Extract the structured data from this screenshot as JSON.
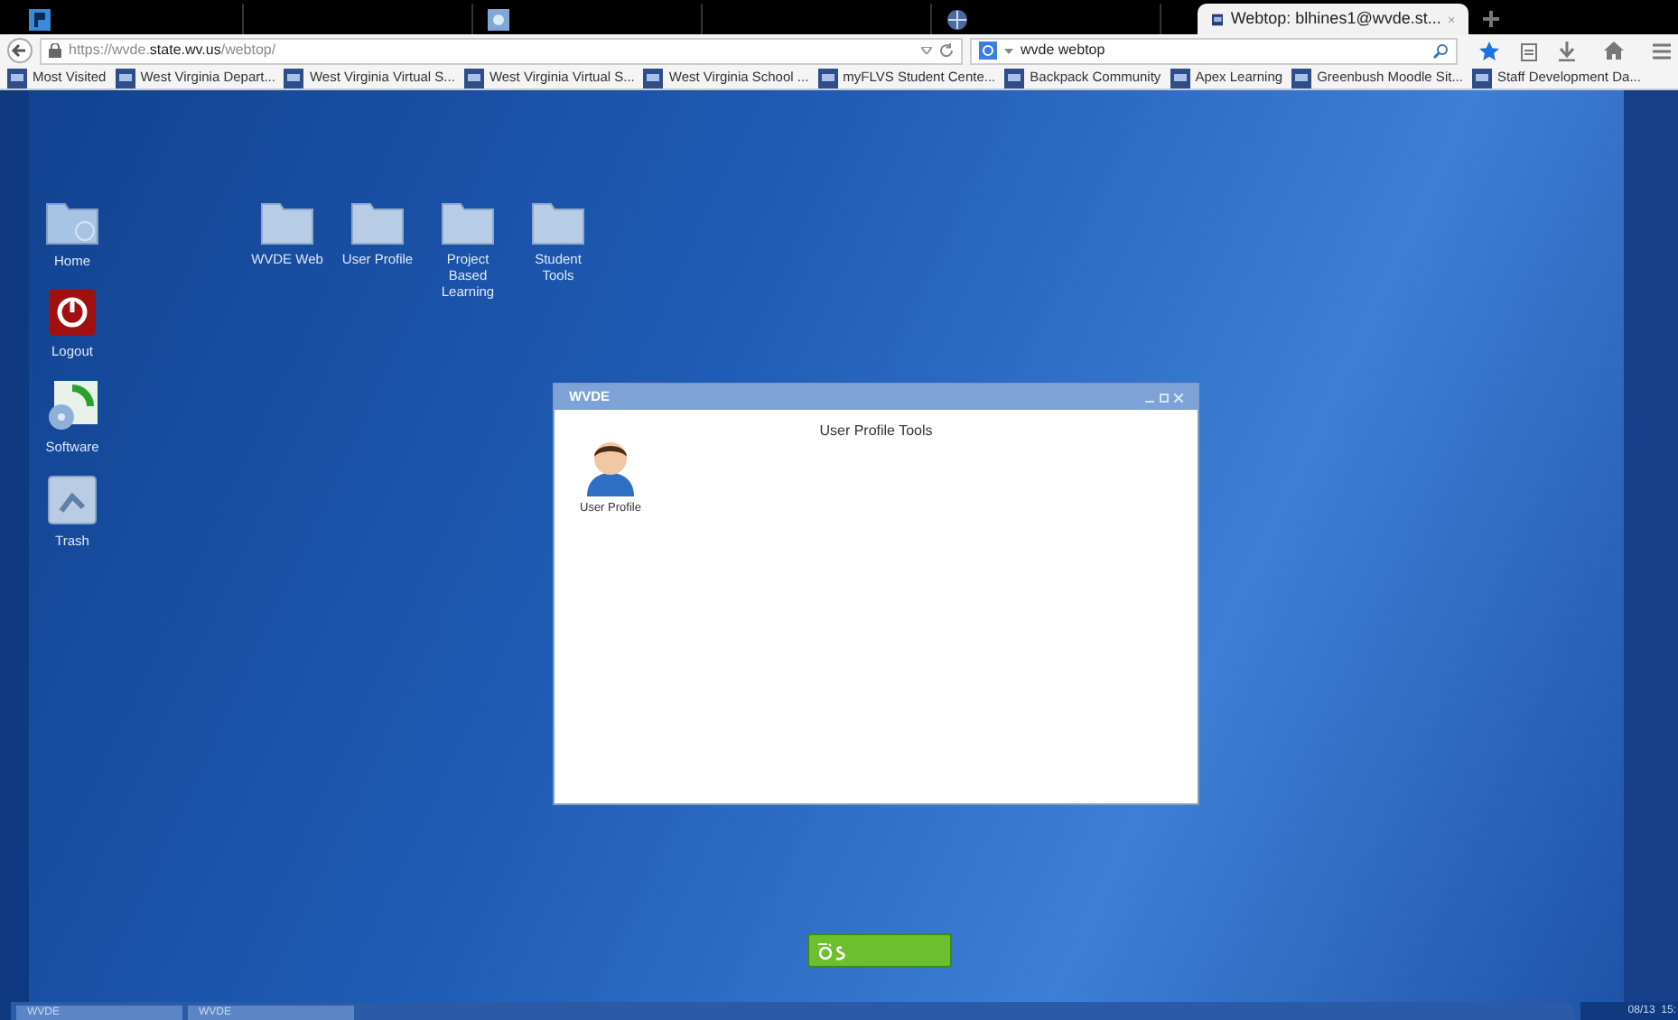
{
  "tabs": [
    {
      "selected": false,
      "kind": "logo"
    },
    {
      "selected": false,
      "kind": "blank"
    },
    {
      "selected": false,
      "kind": "image"
    },
    {
      "selected": false,
      "kind": "blank"
    },
    {
      "selected": false,
      "kind": "globe"
    },
    {
      "label": "Webtop: blhines1@wvde.st...",
      "selected": true,
      "kind": "site"
    }
  ],
  "address": {
    "prefix": "https://wvde.",
    "host": "state.wv.us",
    "path": "/webtop/"
  },
  "search": {
    "value": "wvde webtop"
  },
  "bookmarks": [
    "Most Visited",
    "West Virginia Depart...",
    "West Virginia Virtual S...",
    "West Virginia Virtual S...",
    "West Virginia School ...",
    "myFLVS Student Cente...",
    "Backpack Community",
    "Apex Learning",
    "Greenbush Moodle Sit...",
    "Staff Development Da..."
  ],
  "side_icons": [
    {
      "label": "Home",
      "kind": "home"
    },
    {
      "label": "Logout",
      "kind": "logout"
    },
    {
      "label": "Software",
      "kind": "software"
    },
    {
      "label": "Trash",
      "kind": "trash"
    }
  ],
  "folders": [
    {
      "label": "WVDE Web"
    },
    {
      "label": "User Profile"
    },
    {
      "label": "Project Based Learning"
    },
    {
      "label": "Student Tools"
    }
  ],
  "window": {
    "title": "WVDE",
    "heading": "User Profile Tools",
    "items": [
      {
        "label": "User Profile"
      }
    ]
  },
  "taskbar": {
    "items": [
      "WVDE",
      "WVDE"
    ],
    "clock": "08/13  15:"
  }
}
